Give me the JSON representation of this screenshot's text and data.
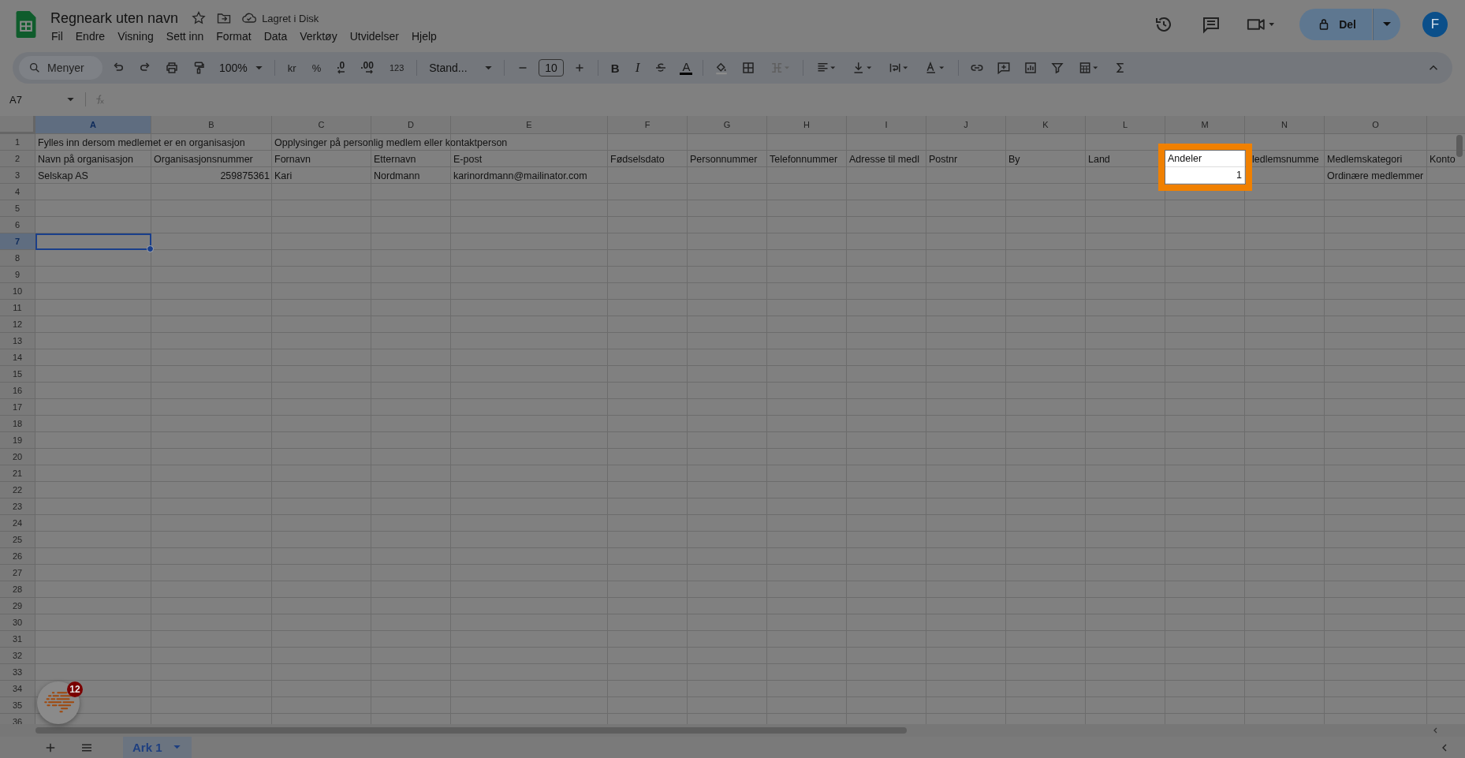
{
  "document": {
    "title": "Regneark uten navn",
    "save_status": "Lagret i Disk",
    "starred": false
  },
  "menu": [
    "Fil",
    "Endre",
    "Visning",
    "Sett inn",
    "Format",
    "Data",
    "Verktøy",
    "Utvidelser",
    "Hjelp"
  ],
  "share": {
    "label": "Del"
  },
  "account": {
    "initial": "F"
  },
  "toolbar": {
    "search": {
      "placeholder": "Menyer"
    },
    "zoom": "100%",
    "currency": "kr",
    "percent": "%",
    "decrease_decimals": ".0",
    "increase_decimals": ".00",
    "number_format": "123",
    "font": "Stand...",
    "font_size": "10",
    "bold": "B",
    "italic": "I",
    "text_color": "A"
  },
  "formula_bar": {
    "name_box": "A7"
  },
  "columns": [
    {
      "label": "A",
      "selected": true
    },
    {
      "label": "B",
      "selected": false
    },
    {
      "label": "C",
      "selected": false
    },
    {
      "label": "D",
      "selected": false
    },
    {
      "label": "E",
      "selected": false
    },
    {
      "label": "F",
      "selected": false
    },
    {
      "label": "G",
      "selected": false
    },
    {
      "label": "H",
      "selected": false
    },
    {
      "label": "I",
      "selected": false
    },
    {
      "label": "J",
      "selected": false
    },
    {
      "label": "K",
      "selected": false
    },
    {
      "label": "L",
      "selected": false
    },
    {
      "label": "M",
      "selected": false
    },
    {
      "label": "N",
      "selected": false
    },
    {
      "label": "O",
      "selected": false
    }
  ],
  "row_numbers": [
    {
      "label": "1",
      "selected": false
    },
    {
      "label": "2",
      "selected": false
    },
    {
      "label": "3",
      "selected": false
    },
    {
      "label": "4",
      "selected": false
    },
    {
      "label": "5",
      "selected": false
    },
    {
      "label": "6",
      "selected": false
    },
    {
      "label": "7",
      "selected": true
    },
    {
      "label": "8",
      "selected": false
    },
    {
      "label": "9",
      "selected": false
    },
    {
      "label": "10",
      "selected": false
    },
    {
      "label": "11",
      "selected": false
    },
    {
      "label": "12",
      "selected": false
    },
    {
      "label": "13",
      "selected": false
    },
    {
      "label": "14",
      "selected": false
    },
    {
      "label": "15",
      "selected": false
    },
    {
      "label": "16",
      "selected": false
    },
    {
      "label": "17",
      "selected": false
    },
    {
      "label": "18",
      "selected": false
    },
    {
      "label": "19",
      "selected": false
    },
    {
      "label": "20",
      "selected": false
    },
    {
      "label": "21",
      "selected": false
    },
    {
      "label": "22",
      "selected": false
    },
    {
      "label": "23",
      "selected": false
    },
    {
      "label": "24",
      "selected": false
    },
    {
      "label": "25",
      "selected": false
    },
    {
      "label": "26",
      "selected": false
    },
    {
      "label": "27",
      "selected": false
    },
    {
      "label": "28",
      "selected": false
    },
    {
      "label": "29",
      "selected": false
    },
    {
      "label": "30",
      "selected": false
    },
    {
      "label": "31",
      "selected": false
    },
    {
      "label": "32",
      "selected": false
    },
    {
      "label": "33",
      "selected": false
    },
    {
      "label": "34",
      "selected": false
    },
    {
      "label": "35",
      "selected": false
    },
    {
      "label": "36",
      "selected": false
    }
  ],
  "rows": [
    {
      "cells": [
        {
          "text": "Fylles inn dersom medlemet er en organisasjon",
          "kind": "text",
          "highlighted": false
        },
        null,
        {
          "text": "Opplysinger på personlig medlem eller kontaktperson",
          "kind": "text",
          "highlighted": false
        }
      ]
    },
    {
      "cells": [
        {
          "text": "Navn på organisasjon",
          "kind": "text",
          "highlighted": false
        },
        {
          "text": "Organisasjonsnummer",
          "kind": "text",
          "highlighted": false
        },
        {
          "text": "Fornavn",
          "kind": "text",
          "highlighted": false
        },
        {
          "text": "Etternavn",
          "kind": "text",
          "highlighted": false
        },
        {
          "text": "E-post",
          "kind": "text",
          "highlighted": false
        },
        {
          "text": "Fødselsdato",
          "kind": "text",
          "highlighted": false
        },
        {
          "text": "Personnummer",
          "kind": "text",
          "highlighted": false
        },
        {
          "text": "Telefonnummer",
          "kind": "text",
          "highlighted": false
        },
        {
          "text": "Adresse til medl",
          "kind": "text",
          "highlighted": false
        },
        {
          "text": "Postnr",
          "kind": "text",
          "highlighted": false
        },
        {
          "text": "By",
          "kind": "text",
          "highlighted": false
        },
        {
          "text": "Land",
          "kind": "text",
          "highlighted": false
        },
        {
          "text": "Andeler",
          "kind": "text",
          "highlighted": true
        },
        {
          "text": "ledlemsnumme",
          "kind": "text",
          "highlighted": false
        },
        {
          "text": "Medlemskategori",
          "kind": "text",
          "highlighted": false
        },
        {
          "text": "Konto",
          "kind": "text",
          "highlighted": false
        }
      ]
    },
    {
      "cells": [
        {
          "text": "Selskap AS",
          "kind": "text",
          "highlighted": false
        },
        {
          "text": "259875361",
          "kind": "number",
          "highlighted": false
        },
        {
          "text": "Kari",
          "kind": "text",
          "highlighted": false
        },
        {
          "text": "Nordmann",
          "kind": "text",
          "highlighted": false
        },
        {
          "text": "karinordmann@mailinator.com",
          "kind": "text",
          "highlighted": false
        },
        null,
        null,
        null,
        null,
        null,
        null,
        null,
        {
          "text": "1",
          "kind": "number",
          "highlighted": true
        },
        null,
        {
          "text": "Ordinære medlemmer",
          "kind": "text",
          "highlighted": false
        }
      ]
    }
  ],
  "sheets": [
    {
      "label": "Ark 1",
      "selected": true
    }
  ],
  "extension": {
    "badge": "12"
  }
}
